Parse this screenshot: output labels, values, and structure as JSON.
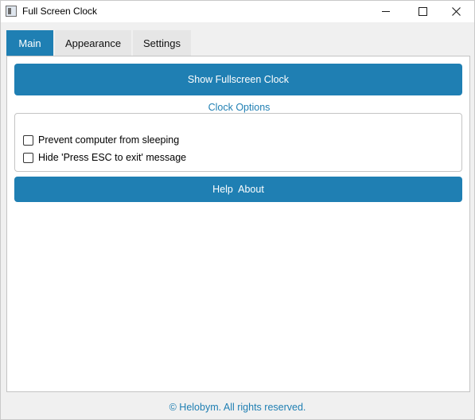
{
  "window": {
    "title": "Full Screen Clock"
  },
  "tabs": [
    {
      "label": "Main",
      "active": true
    },
    {
      "label": "Appearance",
      "active": false
    },
    {
      "label": "Settings",
      "active": false
    }
  ],
  "main": {
    "show_clock_label": "Show Fullscreen Clock",
    "clock_options_title": "Clock Options",
    "options": [
      {
        "label": "Prevent computer from sleeping",
        "checked": false
      },
      {
        "label": "Hide 'Press ESC to exit' message",
        "checked": false
      }
    ],
    "help_about_label": "Help  About"
  },
  "footer": {
    "text": "© Helobym. All rights reserved."
  },
  "colors": {
    "accent": "#1f7fb3",
    "tab_inactive": "#e6e6e6",
    "panel_bg": "#ffffff",
    "window_bg": "#f0f0f0"
  }
}
